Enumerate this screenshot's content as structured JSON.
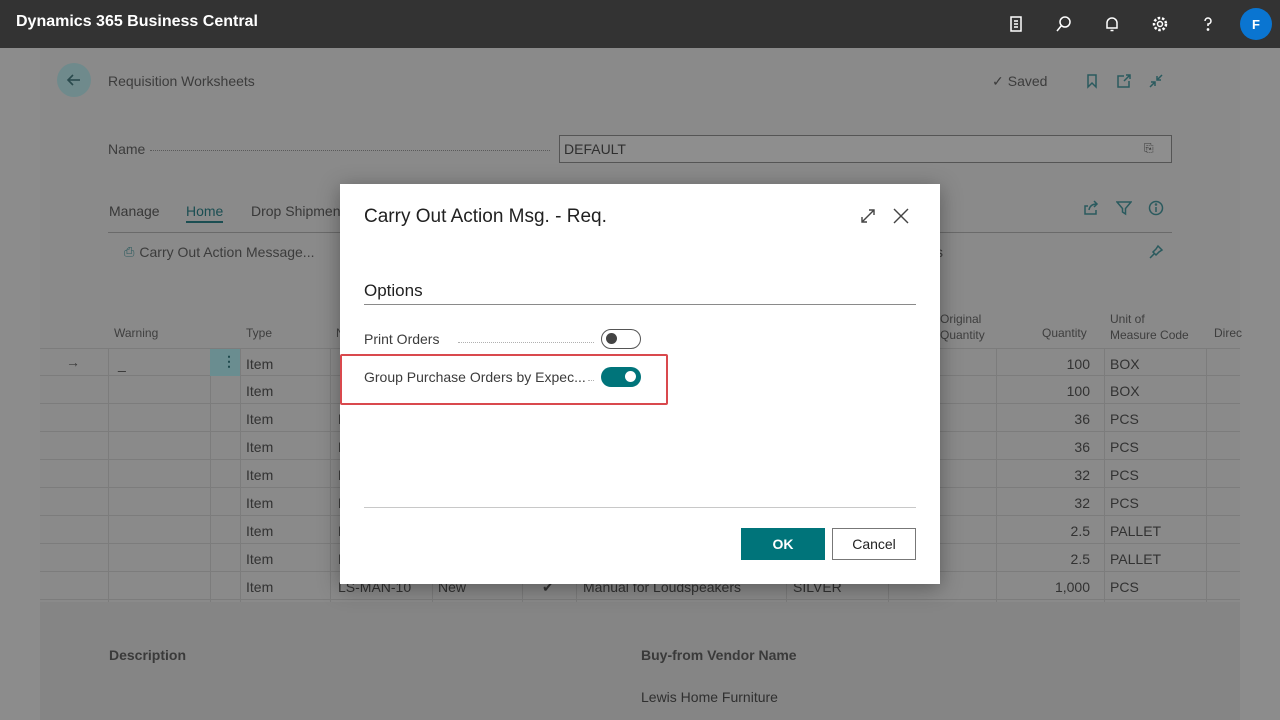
{
  "topbar": {
    "app_title": "Dynamics 365 Business Central",
    "icons": [
      "document-icon",
      "search-icon",
      "bell-icon",
      "gear-icon",
      "help-icon"
    ],
    "avatar_initial": "F"
  },
  "page": {
    "title": "Requisition Worksheets",
    "saved_label": "Saved",
    "name_label": "Name",
    "name_value": "DEFAULT",
    "menu_tabs": [
      "Manage",
      "Home",
      "Drop Shipmen"
    ],
    "action_label": "Carry Out Action Message...",
    "action_partial": "s"
  },
  "grid": {
    "headers": {
      "warning": "Warning",
      "type": "Type",
      "no_partial": "N",
      "original_quantity_1": "Original",
      "original_quantity_2": "Quantity",
      "quantity": "Quantity",
      "uom_1": "Unit of",
      "uom_2": "Measure Code",
      "direct_partial": "Direc"
    },
    "rows": [
      {
        "warning": "_",
        "type": "Item",
        "no": "",
        "action": "",
        "accept": "",
        "description": "",
        "variant": "",
        "quantity": "100",
        "uom": "BOX"
      },
      {
        "warning": "",
        "type": "Item",
        "no": "",
        "action": "",
        "accept": "",
        "description": "",
        "variant": "",
        "quantity": "100",
        "uom": "BOX"
      },
      {
        "warning": "",
        "type": "Item",
        "no": "L",
        "action": "",
        "accept": "",
        "description": "",
        "variant": "",
        "quantity": "36",
        "uom": "PCS"
      },
      {
        "warning": "",
        "type": "Item",
        "no": "L",
        "action": "",
        "accept": "",
        "description": "",
        "variant": "",
        "quantity": "36",
        "uom": "PCS"
      },
      {
        "warning": "",
        "type": "Item",
        "no": "L",
        "action": "",
        "accept": "",
        "description": "",
        "variant": "",
        "quantity": "32",
        "uom": "PCS"
      },
      {
        "warning": "",
        "type": "Item",
        "no": "L",
        "action": "",
        "accept": "",
        "description": "",
        "variant": "",
        "quantity": "32",
        "uom": "PCS"
      },
      {
        "warning": "",
        "type": "Item",
        "no": "L",
        "action": "",
        "accept": "",
        "description": "",
        "variant": "",
        "quantity": "2.5",
        "uom": "PALLET"
      },
      {
        "warning": "",
        "type": "Item",
        "no": "L",
        "action": "",
        "accept": "",
        "description": "",
        "variant": "",
        "quantity": "2.5",
        "uom": "PALLET"
      },
      {
        "warning": "",
        "type": "Item",
        "no": "LS-MAN-10",
        "action": "New",
        "accept": "✔",
        "description": "Manual for Loudspeakers",
        "variant": "SILVER",
        "quantity": "1,000",
        "uom": "PCS"
      }
    ]
  },
  "details": {
    "description_label": "Description",
    "vendor_label": "Buy-from Vendor Name",
    "vendor_value": "Lewis Home Furniture"
  },
  "dialog": {
    "title": "Carry Out Action Msg. - Req.",
    "section": "Options",
    "options": [
      {
        "label": "Print Orders",
        "enabled": false
      },
      {
        "label": "Group Purchase Orders by Expec...",
        "enabled": true
      }
    ],
    "ok_label": "OK",
    "cancel_label": "Cancel"
  },
  "colors": {
    "accent": "#00747a",
    "highlight": "#d9494d",
    "topbar": "#333333"
  }
}
